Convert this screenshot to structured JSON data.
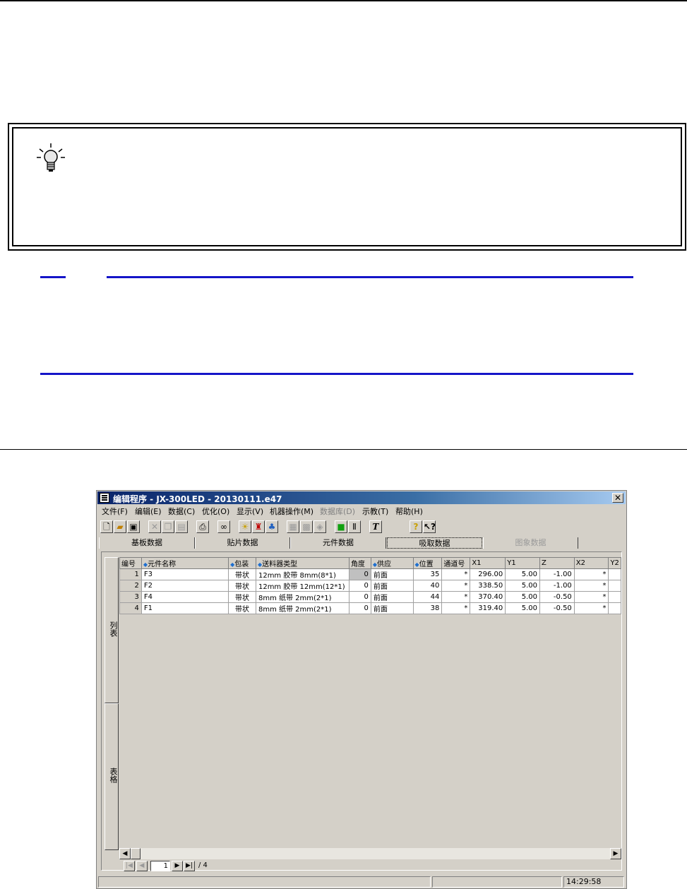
{
  "window": {
    "title": "编辑程序 - JX-300LED - 20130111.e47",
    "close_label": "✕"
  },
  "menu": {
    "items": [
      "文件(F)",
      "编辑(E)",
      "数据(C)",
      "优化(O)",
      "显示(V)",
      "机器操作(M)",
      "数据库(D)",
      "示教(T)",
      "帮助(H)"
    ]
  },
  "toolbar_icons": [
    "new-file-icon",
    "open-folder-icon",
    "save-icon",
    "cut-icon",
    "copy-icon",
    "paste-icon",
    "print-icon",
    "find-icon",
    "light-icon",
    "component-icon",
    "color-icon",
    "disabled-a-icon",
    "disabled-b-icon",
    "disabled-c-icon",
    "green-icon",
    "bracket-icon",
    "text-icon",
    "help-icon",
    "context-help-icon"
  ],
  "tabs": [
    "基板数据",
    "贴片数据",
    "元件数据",
    "吸取数据",
    "图象数据"
  ],
  "side_tabs": {
    "list": "列表",
    "table": "表格"
  },
  "table": {
    "headers": [
      "编号",
      "元件名称",
      "包装",
      "送料器类型",
      "角度",
      "供应",
      "位置",
      "通道号",
      "X1",
      "Y1",
      "Z",
      "X2",
      "Y2"
    ],
    "rows": [
      [
        "1",
        "F3",
        "带状",
        "12mm 胶带  8mm(8*1)",
        "0",
        "前面",
        "35",
        "*",
        "296.00",
        "5.00",
        "-1.00",
        "*",
        ""
      ],
      [
        "2",
        "F2",
        "带状",
        "12mm 胶带  12mm(12*1)",
        "0",
        "前面",
        "40",
        "*",
        "338.50",
        "5.00",
        "-1.00",
        "*",
        ""
      ],
      [
        "3",
        "F4",
        "带状",
        "8mm 纸带  2mm(2*1)",
        "0",
        "前面",
        "44",
        "*",
        "370.40",
        "5.00",
        "-0.50",
        "*",
        ""
      ],
      [
        "4",
        "F1",
        "带状",
        "8mm 纸带  2mm(2*1)",
        "0",
        "前面",
        "38",
        "*",
        "319.40",
        "5.00",
        "-0.50",
        "*",
        ""
      ]
    ]
  },
  "pager": {
    "current": "1",
    "total": "/ 4"
  },
  "status": {
    "time": "14:29:58"
  }
}
